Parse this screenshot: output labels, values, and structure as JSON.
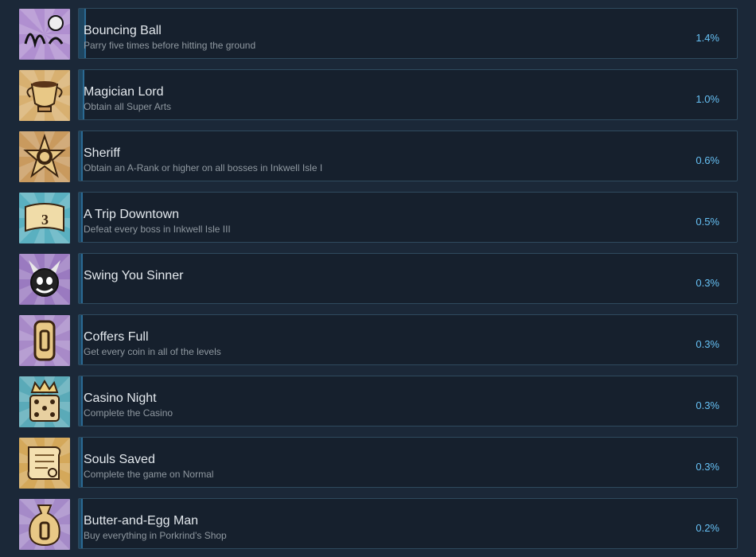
{
  "achievements": [
    {
      "title": "Bouncing Ball",
      "description": "Parry five times before hitting the ground",
      "percent": "1.4%",
      "progress": 0.014,
      "icon": "bouncing-ball-icon",
      "bg": "#b08fd0"
    },
    {
      "title": "Magician Lord",
      "description": "Obtain all Super Arts",
      "percent": "1.0%",
      "progress": 0.01,
      "icon": "trophy-cup-icon",
      "bg": "#d8b070"
    },
    {
      "title": "Sheriff",
      "description": "Obtain an A-Rank or higher on all bosses in Inkwell Isle I",
      "percent": "0.6%",
      "progress": 0.006,
      "icon": "sheriff-badge-icon",
      "bg": "#c99a5e"
    },
    {
      "title": "A Trip Downtown",
      "description": "Defeat every boss in Inkwell Isle III",
      "percent": "0.5%",
      "progress": 0.005,
      "icon": "map-scroll-icon",
      "bg": "#5ab0c0"
    },
    {
      "title": "Swing You Sinner",
      "description": "",
      "percent": "0.3%",
      "progress": 0.003,
      "icon": "devil-head-icon",
      "bg": "#9a7ac0"
    },
    {
      "title": "Coffers Full",
      "description": "Get every coin in all of the levels",
      "percent": "0.3%",
      "progress": 0.003,
      "icon": "coin-icon",
      "bg": "#a88ac8"
    },
    {
      "title": "Casino Night",
      "description": "Complete the Casino",
      "percent": "0.3%",
      "progress": 0.003,
      "icon": "crowned-dice-icon",
      "bg": "#5aaab8"
    },
    {
      "title": "Souls Saved",
      "description": "Complete the game on Normal",
      "percent": "0.3%",
      "progress": 0.003,
      "icon": "contract-scroll-icon",
      "bg": "#d4a85a"
    },
    {
      "title": "Butter-and-Egg Man",
      "description": "Buy everything in Porkrind's Shop",
      "percent": "0.2%",
      "progress": 0.002,
      "icon": "money-bag-icon",
      "bg": "#a58ac8"
    }
  ]
}
